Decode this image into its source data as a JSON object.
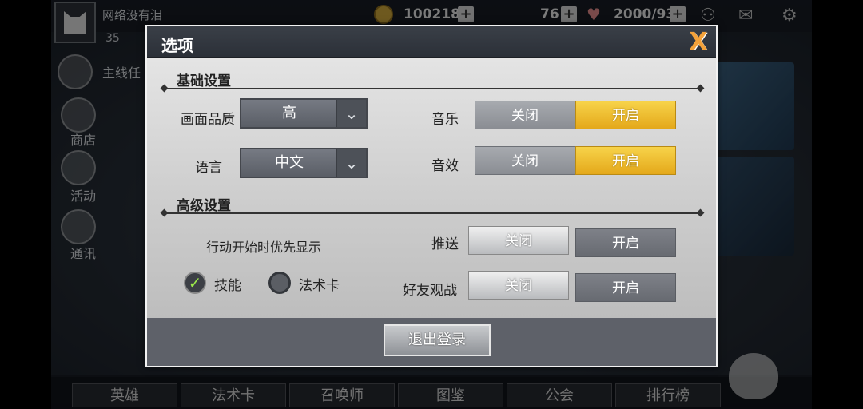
{
  "background": {
    "player_name": "网络没有泪",
    "player_level": "35",
    "resources": {
      "gold": "100218",
      "stamina": "76",
      "hearts": "2000/93"
    },
    "side_nav": [
      "主线任",
      "商店",
      "活动",
      "通讯"
    ],
    "bottom_nav": [
      "英雄",
      "法术卡",
      "召唤师",
      "图鉴",
      "公会",
      "排行榜"
    ]
  },
  "dialog": {
    "title": "选项",
    "close_label": "X",
    "basic_section": "基础设置",
    "advanced_section": "高级设置",
    "graphics": {
      "label": "画面品质",
      "value": "高"
    },
    "language": {
      "label": "语言",
      "value": "中文"
    },
    "music": {
      "label": "音乐",
      "off": "关闭",
      "on": "开启",
      "state": "on"
    },
    "sound": {
      "label": "音效",
      "off": "关闭",
      "on": "开启",
      "state": "on"
    },
    "priority": {
      "label": "行动开始时优先显示",
      "skill": "技能",
      "spell_card": "法术卡",
      "selected": "skill"
    },
    "push": {
      "label": "推送",
      "off": "关闭",
      "on": "开启",
      "state": "off"
    },
    "friend_watch": {
      "label": "好友观战",
      "off": "关闭",
      "on": "开启",
      "state": "off"
    },
    "logout_label": "退出登录"
  },
  "colors": {
    "accent_on": "#f2c232",
    "close": "#f4a23a",
    "check": "#9be84a"
  }
}
